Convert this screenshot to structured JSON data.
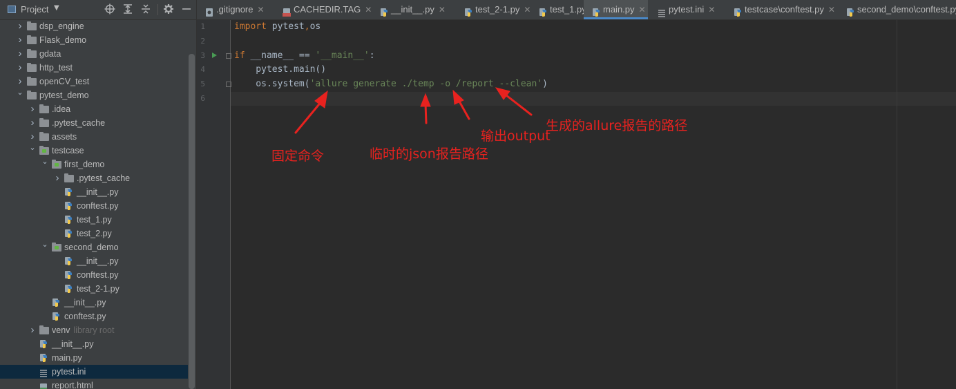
{
  "sidebar": {
    "title": "Project",
    "toolbar_icons": [
      "locate-icon",
      "expand-all-icon",
      "collapse-all-icon",
      "gear-icon",
      "hide-icon"
    ],
    "items": [
      {
        "label": "dsp_engine",
        "type": "folder",
        "depth": 0,
        "expanded": false
      },
      {
        "label": "Flask_demo",
        "type": "folder",
        "depth": 0,
        "expanded": false
      },
      {
        "label": "gdata",
        "type": "folder",
        "depth": 0,
        "expanded": false
      },
      {
        "label": "http_test",
        "type": "folder",
        "depth": 0,
        "expanded": false
      },
      {
        "label": "openCV_test",
        "type": "folder",
        "depth": 0,
        "expanded": false
      },
      {
        "label": "pytest_demo",
        "type": "folder",
        "depth": 0,
        "expanded": true
      },
      {
        "label": ".idea",
        "type": "folder",
        "depth": 1,
        "expanded": false
      },
      {
        "label": ".pytest_cache",
        "type": "folder",
        "depth": 1,
        "expanded": false
      },
      {
        "label": "assets",
        "type": "folder",
        "depth": 1,
        "expanded": false
      },
      {
        "label": "testcase",
        "type": "folder-test",
        "depth": 1,
        "expanded": true
      },
      {
        "label": "first_demo",
        "type": "folder-test",
        "depth": 2,
        "expanded": true
      },
      {
        "label": ".pytest_cache",
        "type": "folder",
        "depth": 3,
        "expanded": false
      },
      {
        "label": "__init__.py",
        "type": "py",
        "depth": 3
      },
      {
        "label": "conftest.py",
        "type": "py",
        "depth": 3
      },
      {
        "label": "test_1.py",
        "type": "py",
        "depth": 3
      },
      {
        "label": "test_2.py",
        "type": "py",
        "depth": 3
      },
      {
        "label": "second_demo",
        "type": "folder-test",
        "depth": 2,
        "expanded": true
      },
      {
        "label": "__init__.py",
        "type": "py",
        "depth": 3
      },
      {
        "label": "conftest.py",
        "type": "py",
        "depth": 3
      },
      {
        "label": "test_2-1.py",
        "type": "py",
        "depth": 3
      },
      {
        "label": "__init__.py",
        "type": "py",
        "depth": 2
      },
      {
        "label": "conftest.py",
        "type": "py",
        "depth": 2
      },
      {
        "label": "venv",
        "hint": "library root",
        "type": "folder",
        "depth": 1,
        "expanded": false
      },
      {
        "label": "__init__.py",
        "type": "py",
        "depth": 1
      },
      {
        "label": "main.py",
        "type": "py",
        "depth": 1
      },
      {
        "label": "pytest.ini",
        "type": "ini",
        "depth": 1,
        "selected": true
      },
      {
        "label": "report.html",
        "type": "html",
        "depth": 1
      }
    ]
  },
  "tabs": [
    {
      "label": ".gitignore",
      "icon": "gitignore-file-icon"
    },
    {
      "label": "CACHEDIR.TAG",
      "icon": "tag-file-icon"
    },
    {
      "label": "__init__.py",
      "icon": "python-file-icon"
    },
    {
      "label": "test_2-1.py",
      "icon": "python-file-icon"
    },
    {
      "label": "test_1.py",
      "icon": "python-file-icon"
    },
    {
      "label": "main.py",
      "icon": "python-file-icon",
      "active": true
    },
    {
      "label": "pytest.ini",
      "icon": "ini-file-icon"
    },
    {
      "label": "testcase\\conftest.py",
      "icon": "python-file-icon"
    },
    {
      "label": "second_demo\\conftest.py",
      "icon": "python-file-icon"
    }
  ],
  "editor": {
    "line_numbers": [
      "1",
      "2",
      "3",
      "4",
      "5",
      "6"
    ],
    "lines": {
      "l1": {
        "kw": "import",
        "rest": " pytest",
        "comma": ",",
        "rest2": "os"
      },
      "l3": {
        "kw": "if",
        "rest": " __name__ == ",
        "str": "'__main__'",
        "end": ":"
      },
      "l4": {
        "text": "    pytest.main()"
      },
      "l5": {
        "pre": "    os.system(",
        "str": "'allure generate ./temp -o /report --clean'",
        "end": ")"
      }
    }
  },
  "annotations": {
    "fixed_command": "固定命令",
    "temp_json": "临时的json报告路径",
    "output": "输出output",
    "report_path": "生成的allure报告的路径"
  },
  "colors": {
    "annotation_red": "#e8221f",
    "keyword": "#cc7832",
    "string": "#6a8759",
    "text": "#a9b7c6",
    "selection": "#0d293e",
    "tab_active_underline": "#4a88c7"
  }
}
